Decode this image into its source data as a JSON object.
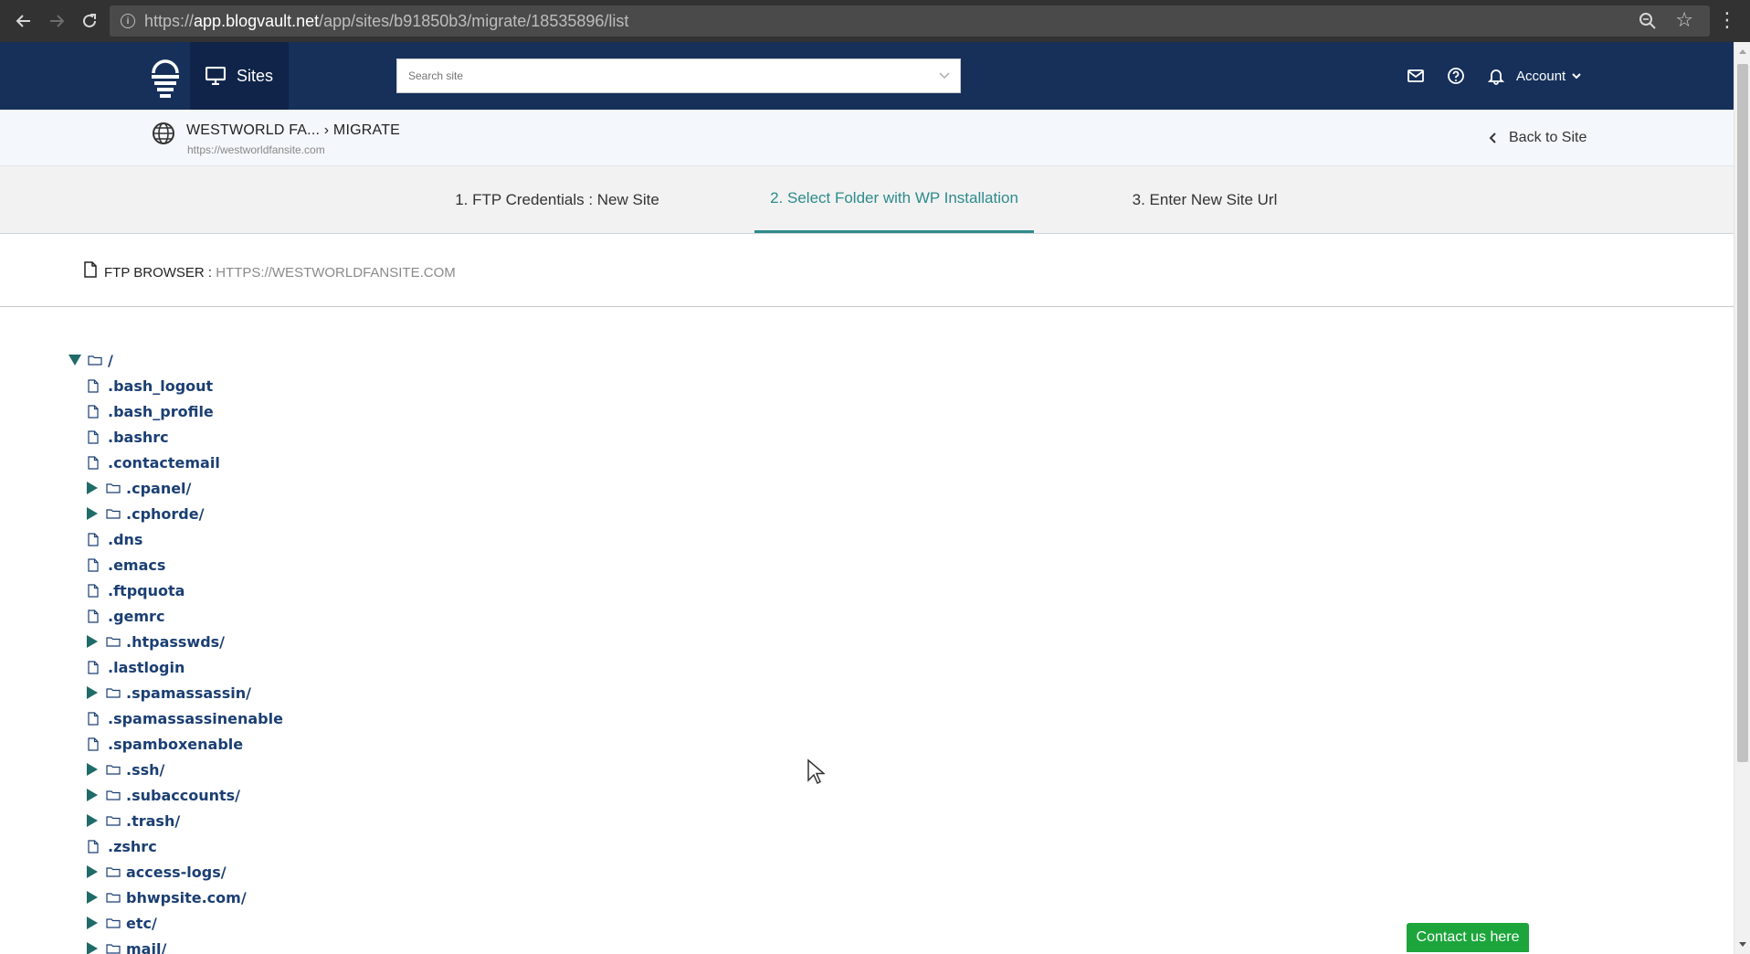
{
  "browser": {
    "url_prefix": "https://",
    "url_host": "app.blogvault.net",
    "url_path": "/app/sites/b91850b3/migrate/18535896/list"
  },
  "header": {
    "sites_label": "Sites",
    "search_placeholder": "Search site",
    "account_label": "Account"
  },
  "breadcrumb": {
    "title": "WESTWORLD FA... › MIGRATE",
    "site_url": "https://westworldfansite.com",
    "back_label": "Back to Site"
  },
  "steps": [
    {
      "label": "1. FTP Credentials : New Site",
      "active": false
    },
    {
      "label": "2. Select Folder with WP Installation",
      "active": true
    },
    {
      "label": "3. Enter New Site Url",
      "active": false
    }
  ],
  "ftp_browser": {
    "label": "FTP BROWSER : ",
    "site": "HTTPS://WESTWORLDFANSITE.COM"
  },
  "tree": {
    "root": "/",
    "items": [
      {
        "name": ".bash_logout",
        "type": "file"
      },
      {
        "name": ".bash_profile",
        "type": "file"
      },
      {
        "name": ".bashrc",
        "type": "file"
      },
      {
        "name": ".contactemail",
        "type": "file"
      },
      {
        "name": ".cpanel/",
        "type": "folder"
      },
      {
        "name": ".cphorde/",
        "type": "folder"
      },
      {
        "name": ".dns",
        "type": "file"
      },
      {
        "name": ".emacs",
        "type": "file"
      },
      {
        "name": ".ftpquota",
        "type": "file"
      },
      {
        "name": ".gemrc",
        "type": "file"
      },
      {
        "name": ".htpasswds/",
        "type": "folder"
      },
      {
        "name": ".lastlogin",
        "type": "file"
      },
      {
        "name": ".spamassassin/",
        "type": "folder"
      },
      {
        "name": ".spamassassinenable",
        "type": "file"
      },
      {
        "name": ".spamboxenable",
        "type": "file"
      },
      {
        "name": ".ssh/",
        "type": "folder"
      },
      {
        "name": ".subaccounts/",
        "type": "folder"
      },
      {
        "name": ".trash/",
        "type": "folder"
      },
      {
        "name": ".zshrc",
        "type": "file"
      },
      {
        "name": "access-logs/",
        "type": "folder"
      },
      {
        "name": "bhwpsite.com/",
        "type": "folder"
      },
      {
        "name": "etc/",
        "type": "folder"
      },
      {
        "name": "mail/",
        "type": "folder"
      }
    ]
  },
  "contact_label": "Contact us here",
  "colors": {
    "header_bg": "#16305a",
    "active_step": "#2e8b8b",
    "tree_text": "#1b3f73",
    "contact_bg": "#1ca53b"
  }
}
